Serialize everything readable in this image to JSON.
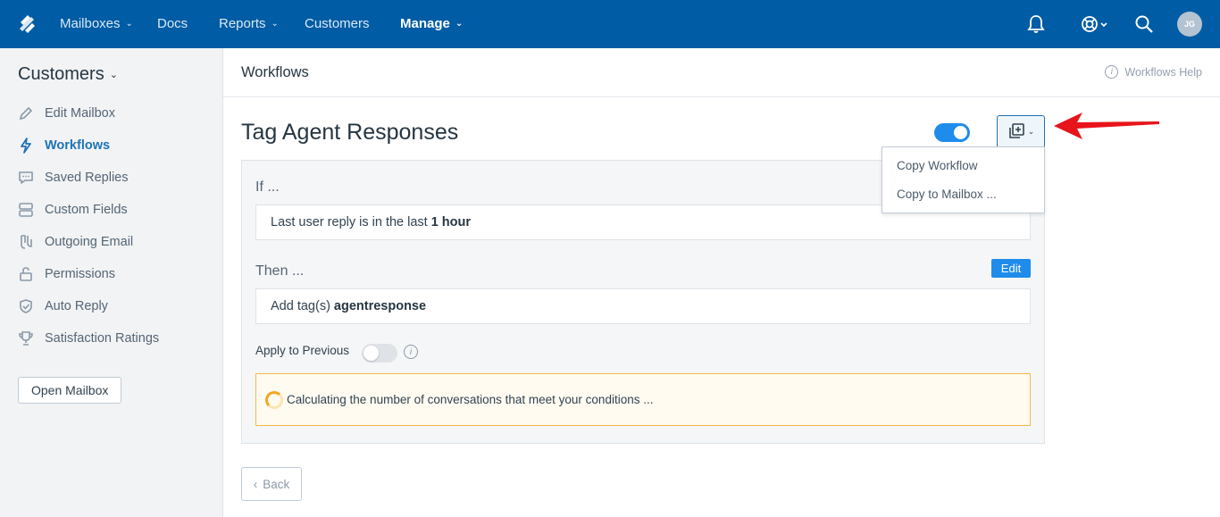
{
  "topnav": {
    "items": [
      {
        "label": "Mailboxes",
        "has_dropdown": true
      },
      {
        "label": "Docs",
        "has_dropdown": false
      },
      {
        "label": "Reports",
        "has_dropdown": true
      },
      {
        "label": "Customers",
        "has_dropdown": false
      },
      {
        "label": "Manage",
        "has_dropdown": true,
        "active": true
      }
    ],
    "avatar_initials": "JG",
    "icons": [
      "bell-icon",
      "help-lifebuoy-icon",
      "search-icon"
    ],
    "bg_color": "#005ca4"
  },
  "sidebar": {
    "title": "Customers",
    "items": [
      {
        "label": "Edit Mailbox",
        "icon": "pencil-icon"
      },
      {
        "label": "Workflows",
        "icon": "lightning-icon",
        "active": true
      },
      {
        "label": "Saved Replies",
        "icon": "chat-bubble-icon"
      },
      {
        "label": "Custom Fields",
        "icon": "fields-icon"
      },
      {
        "label": "Outgoing Email",
        "icon": "outgoing-icon"
      },
      {
        "label": "Permissions",
        "icon": "lock-icon"
      },
      {
        "label": "Auto Reply",
        "icon": "shield-check-icon"
      },
      {
        "label": "Satisfaction Ratings",
        "icon": "trophy-icon"
      }
    ],
    "open_mailbox_label": "Open Mailbox"
  },
  "header": {
    "title": "Workflows",
    "help_label": "Workflows Help"
  },
  "workflow": {
    "title": "Tag Agent Responses",
    "enabled": true,
    "if_label": "If ...",
    "condition_text": "Last user reply is in the last",
    "condition_value": "1 hour",
    "then_label": "Then ...",
    "edit_label": "Edit",
    "action_text": "Add tag(s)",
    "action_value": "agentresponse",
    "apply_previous_label": "Apply to Previous",
    "apply_previous_enabled": false,
    "calculating_text": "Calculating the number of conversations that meet your conditions ..."
  },
  "copy_menu": {
    "items": [
      "Copy Workflow",
      "Copy to Mailbox ..."
    ]
  },
  "back_label": "Back",
  "colors": {
    "accent": "#1f8ceb",
    "active_link": "#1f73b7",
    "warning_border": "#f5b947",
    "annotation_arrow": "#e8141b"
  }
}
